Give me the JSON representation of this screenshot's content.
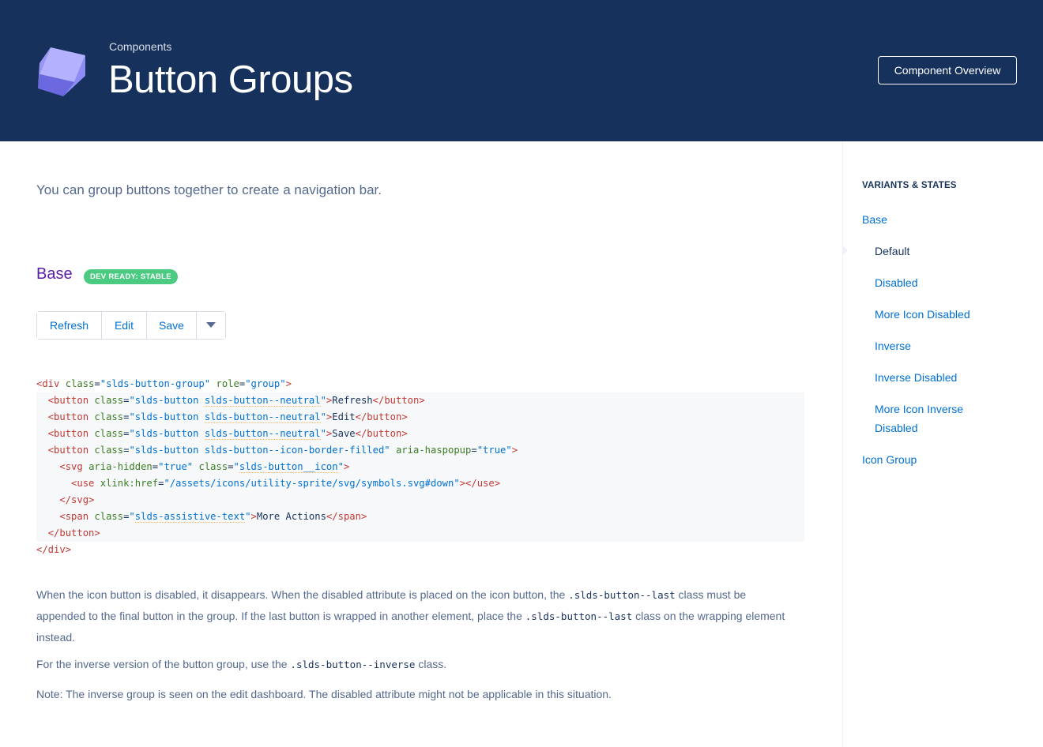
{
  "header": {
    "eyebrow": "Components",
    "title": "Button Groups",
    "overview_button": "Component Overview"
  },
  "intro": "You can group buttons together to create a navigation bar.",
  "section": {
    "title": "Base",
    "badge": "DEV READY: STABLE"
  },
  "button_group": {
    "refresh": "Refresh",
    "edit": "Edit",
    "save": "Save",
    "more_icon": "chevron-down-icon"
  },
  "code_lines": [
    "<div class=\"slds-button-group\" role=\"group\">",
    "  <button class=\"slds-button slds-button--neutral\">Refresh</button>",
    "  <button class=\"slds-button slds-button--neutral\">Edit</button>",
    "  <button class=\"slds-button slds-button--neutral\">Save</button>",
    "  <button class=\"slds-button slds-button--icon-border-filled\" aria-haspopup=\"true\">",
    "    <svg aria-hidden=\"true\" class=\"slds-button__icon\">",
    "      <use xlink:href=\"/assets/icons/utility-sprite/svg/symbols.svg#down\"></use>",
    "    </svg>",
    "    <span class=\"slds-assistive-text\">More Actions</span>",
    "  </button>",
    "</div>"
  ],
  "paragraphs": {
    "p1_a": "When the icon button is disabled, it disappears. When the disabled attribute is placed on the icon button, the ",
    "p1_code1": ".slds-button--last",
    "p1_b": " class must be appended to the final button in the group. If the last button is wrapped in another element, place the ",
    "p1_code2": ".slds-button--last",
    "p1_c": " class on the wrapping element instead.",
    "p2_a": "For the inverse version of the button group, use the ",
    "p2_code": ".slds-button--inverse",
    "p2_b": " class.",
    "p3": "Note: The inverse group is seen on the edit dashboard. The disabled attribute might not be applicable in this situation."
  },
  "sidebar": {
    "heading": "VARIANTS & STATES",
    "base": "Base",
    "default": "Default",
    "disabled": "Disabled",
    "more_icon_disabled": "More Icon Disabled",
    "inverse": "Inverse",
    "inverse_disabled": "Inverse Disabled",
    "more_icon_inverse_1": "More Icon Inverse",
    "more_icon_inverse_2": "Disabled",
    "icon_group": "Icon Group"
  },
  "colors": {
    "header_bg": "#16325c",
    "link": "#0070d2",
    "badge": "#4bca81",
    "section_title": "#5a1ba9"
  }
}
